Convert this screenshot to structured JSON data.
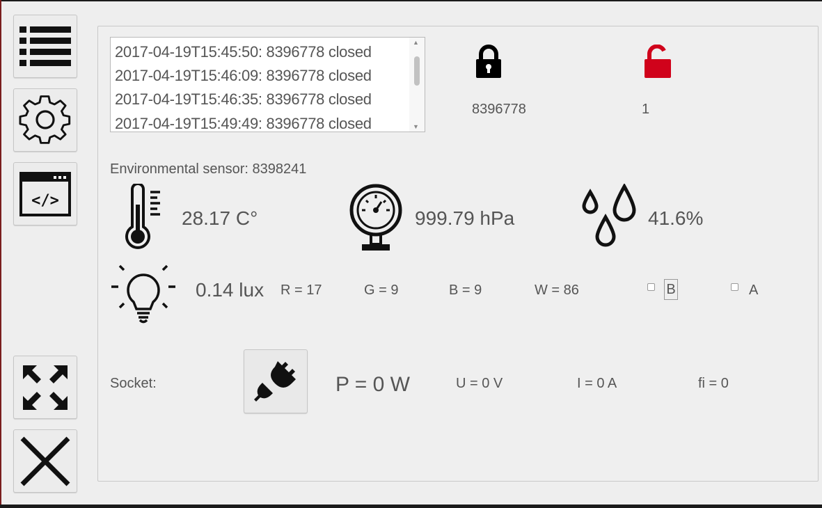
{
  "sidebar": {
    "buttons": [
      {
        "name": "list-button",
        "icon": "list-icon"
      },
      {
        "name": "settings-button",
        "icon": "gear-icon"
      },
      {
        "name": "code-button",
        "icon": "code-window-icon"
      },
      {
        "name": "fullscreen-button",
        "icon": "expand-arrows-icon"
      },
      {
        "name": "close-button",
        "icon": "close-icon"
      }
    ]
  },
  "log": {
    "lines": [
      "2017-04-19T15:45:50: 8396778 closed",
      "2017-04-19T15:46:09: 8396778 closed",
      "2017-04-19T15:46:35: 8396778 closed",
      "2017-04-19T15:49:49: 8396778 closed"
    ]
  },
  "locks": {
    "closed": {
      "icon": "lock-closed-icon",
      "color": "#000000",
      "value": "8396778"
    },
    "open": {
      "icon": "lock-open-icon",
      "color": "#d0021b",
      "value": "1"
    }
  },
  "environment": {
    "label": "Environmental sensor: 8398241",
    "temperature": "28.17 C°",
    "pressure": "999.79 hPa",
    "humidity": "41.6%",
    "light": "0.14 lux",
    "r": "R = 17",
    "g": "G = 9",
    "b": "B = 9",
    "w": "W = 86",
    "checkbox_b": "B",
    "checkbox_a": "A"
  },
  "socket": {
    "label": "Socket:",
    "icon": "plug-disconnected-icon",
    "power": "P = 0 W",
    "voltage": "U = 0 V",
    "current": "I = 0 A",
    "phi": "fi = 0"
  }
}
